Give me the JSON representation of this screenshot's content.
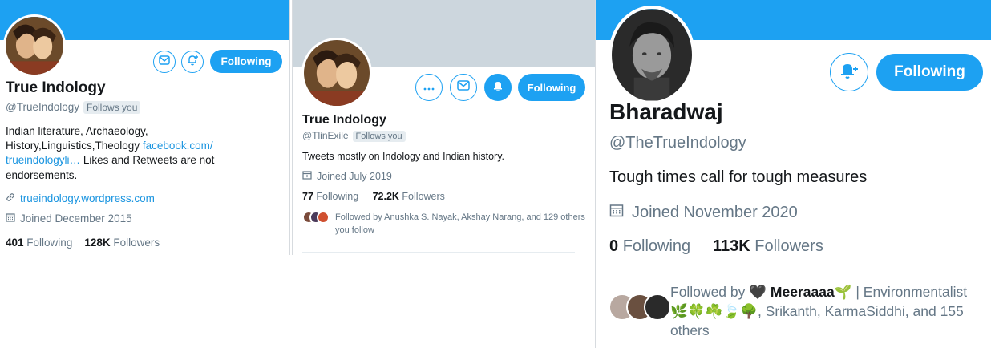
{
  "panel1": {
    "name": "True Indology",
    "handle": "@TrueIndology",
    "follows_you": "Follows you",
    "bio_text": "Indian literature, Archaeology, History,Linguistics,Theology",
    "bio_link": "facebook.com/ trueindologyli…",
    "bio_tail": "Likes and Retweets are not endorsements.",
    "website": "trueindology.wordpress.com",
    "joined": "Joined December 2015",
    "following_count": "401",
    "following_label": "Following",
    "followers_count": "128K",
    "followers_label": "Followers",
    "follow_button": "Following",
    "icons": [
      "message-icon",
      "notification-add-icon",
      "link-icon",
      "calendar-icon"
    ]
  },
  "panel2": {
    "name": "True Indology",
    "handle": "@TlinExile",
    "follows_you": "Follows you",
    "bio": "Tweets mostly on Indology and Indian history.",
    "joined": "Joined July 2019",
    "following_count": "77",
    "following_label": "Following",
    "followers_count": "72.2K",
    "followers_label": "Followers",
    "followed_by": "Followed by Anushka S. Nayak, Akshay Narang, and 129 others you follow",
    "follow_button": "Following",
    "icons": [
      "more-icon",
      "message-icon",
      "notification-on-icon",
      "calendar-icon"
    ]
  },
  "panel3": {
    "name": "Bharadwaj",
    "handle": "@TheTrueIndology",
    "bio": "Tough times call for tough measures",
    "joined": "Joined November 2020",
    "following_count": "0",
    "following_label": "Following",
    "followers_count": "113K",
    "followers_label": "Followers",
    "followed_by_prefix": "Followed by 🖤",
    "followed_by_name": "Meeraaaa🌱",
    "followed_by_rest": "| Environmentalist 🌿🍀☘️🍃🌳, Srikanth, KarmaSiddhi, and 155 others",
    "follow_button": "Following",
    "icons": [
      "notification-add-icon",
      "calendar-icon"
    ]
  },
  "colors": {
    "accent": "#1da1f2",
    "muted": "#657786",
    "text": "#14171a",
    "banner_grey": "#ccd6dd"
  }
}
